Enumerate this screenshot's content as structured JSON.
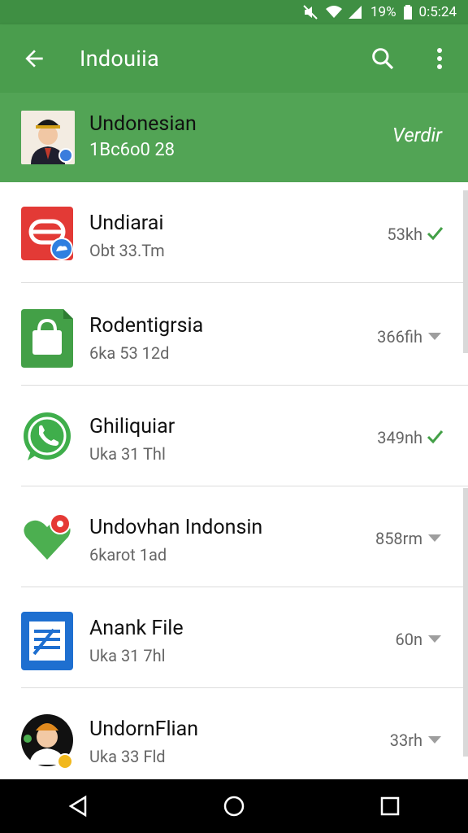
{
  "status_bar": {
    "battery": "19%",
    "time": "0:5:24"
  },
  "app_bar": {
    "title": "Indouiia"
  },
  "header": {
    "name": "Undonesian",
    "sub": "1Bc6o0 28",
    "action": "Verdir"
  },
  "list": [
    {
      "title": "Undiarai",
      "subtitle": "Obt 33.Tm",
      "size": "53kh",
      "status": "check"
    },
    {
      "title": "Rodentigrsia",
      "subtitle": "6ka 53 12d",
      "size": "366fih",
      "status": "dropdown"
    },
    {
      "title": "Ghiliquiar",
      "subtitle": "Uka 31 Thl",
      "size": "349nh",
      "status": "check"
    },
    {
      "title": "Undovhan Indonsin",
      "subtitle": "6karot 1ad",
      "size": "858rm",
      "status": "dropdown"
    },
    {
      "title": "Anank File",
      "subtitle": "Uka 31 7hl",
      "size": "60n",
      "status": "dropdown"
    },
    {
      "title": "UndornFlian",
      "subtitle": "Uka 33 Fld",
      "size": "33rh",
      "status": "dropdown"
    }
  ],
  "icons": {
    "row0": "red-app-icon",
    "row1": "shopping-bag-icon",
    "row2": "whatsapp-icon",
    "row3": "heart-pin-icon",
    "row4": "document-icon",
    "row5": "avatar-icon"
  },
  "colors": {
    "primary": "#4a9d4d",
    "status": "#3f8f43",
    "check": "#43a047",
    "arrow": "#9e9e9e"
  }
}
